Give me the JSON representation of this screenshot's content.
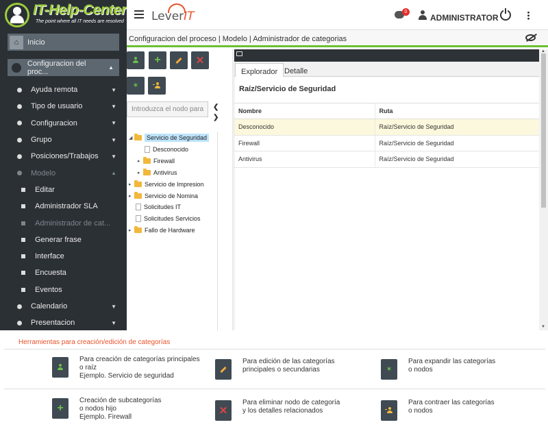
{
  "brand": {
    "logo_title": "IT-Help-Center",
    "logo_tagline": "The point where all IT needs are resolved",
    "lever_text": "Lever",
    "lever_suffix": "IT"
  },
  "header": {
    "notification_count": "0",
    "username": "ADMINISTRATOR"
  },
  "sidebar": {
    "top_items": [
      {
        "label": "Inicio",
        "icon": "home-icon"
      },
      {
        "label": "Configuracion del proc...",
        "icon": "circle-icon"
      }
    ],
    "items": [
      {
        "label": "Ayuda remota",
        "type": "bullet"
      },
      {
        "label": "Tipo de usuario",
        "type": "bullet"
      },
      {
        "label": "Configuracion",
        "type": "bullet"
      },
      {
        "label": "Grupo",
        "type": "bullet"
      },
      {
        "label": "Posiciones/Trabajos",
        "type": "bullet"
      },
      {
        "label": "Modelo",
        "type": "bullet",
        "expanded": true
      },
      {
        "label": "Editar",
        "type": "square"
      },
      {
        "label": "Administrador SLA",
        "type": "square"
      },
      {
        "label": "Administrador de cat...",
        "type": "square",
        "active": true
      },
      {
        "label": "Generar frase",
        "type": "square"
      },
      {
        "label": "Interface",
        "type": "square"
      },
      {
        "label": "Encuesta",
        "type": "square"
      },
      {
        "label": "Eventos",
        "type": "square"
      },
      {
        "label": "Calendario",
        "type": "bullet"
      },
      {
        "label": "Presentacion",
        "type": "bullet"
      }
    ]
  },
  "breadcrumb": {
    "text": "Configuracion del proceso | Modelo | Administrador de categorias"
  },
  "tree": {
    "search_placeholder": "Introduzca el nodo para",
    "nodes": [
      {
        "label": "Servicio de Seguridad",
        "kind": "folder",
        "selected": true
      },
      {
        "label": "Desconocido",
        "kind": "file"
      },
      {
        "label": "Firewall",
        "kind": "folder"
      },
      {
        "label": "Antivirus",
        "kind": "folder"
      },
      {
        "label": "Servicio de Impresion",
        "kind": "folder"
      },
      {
        "label": "Servicio de Nomina",
        "kind": "folder"
      },
      {
        "label": "Solicitudes IT",
        "kind": "file"
      },
      {
        "label": "Solicitudes Servicios",
        "kind": "file"
      },
      {
        "label": "Fallo de Hardware",
        "kind": "folder"
      }
    ]
  },
  "explorer": {
    "tabs": [
      {
        "label": "Explorador"
      },
      {
        "label": "Detalle"
      }
    ],
    "path_title": "Raíz/Servicio de Seguridad",
    "columns": [
      "Nombre",
      "Ruta"
    ],
    "rows": [
      {
        "nombre": "Desconocido",
        "ruta": "Raíz/Servicio de Seguridad"
      },
      {
        "nombre": "Firewall",
        "ruta": "Raíz/Servicio de Seguridad"
      },
      {
        "nombre": "Antivirus",
        "ruta": "Raíz/Servicio de Seguridad"
      }
    ]
  },
  "tools": {
    "title": "Herramientas para creación/edición de categorías",
    "items": [
      {
        "text": "Para creación de categorías principales\no raíz\nEjemplo. Servicio de seguridad",
        "icon": "add-root-user-icon"
      },
      {
        "text": "Para edición de las categorías\nprincipales o secundarias",
        "icon": "edit-pencil-icon"
      },
      {
        "text": "Para expandir las categorías\no nodos",
        "icon": "expand-icon"
      },
      {
        "text": "Creación de subcategorías\no nodos hijo\nEjemplo. Firewall",
        "icon": "add-plus-icon"
      },
      {
        "text": "Para eliminar nodo de categoría\ny los detalles relacionados",
        "icon": "delete-x-icon"
      },
      {
        "text": "Para contraer las categorías\no nodos",
        "icon": "collapse-icon"
      }
    ]
  },
  "colors": {
    "accent_green": "#6ac033",
    "sidebar_bg": "#2b3035",
    "tools_title": "#e8522a",
    "selected_row": "#fcf8dd"
  }
}
